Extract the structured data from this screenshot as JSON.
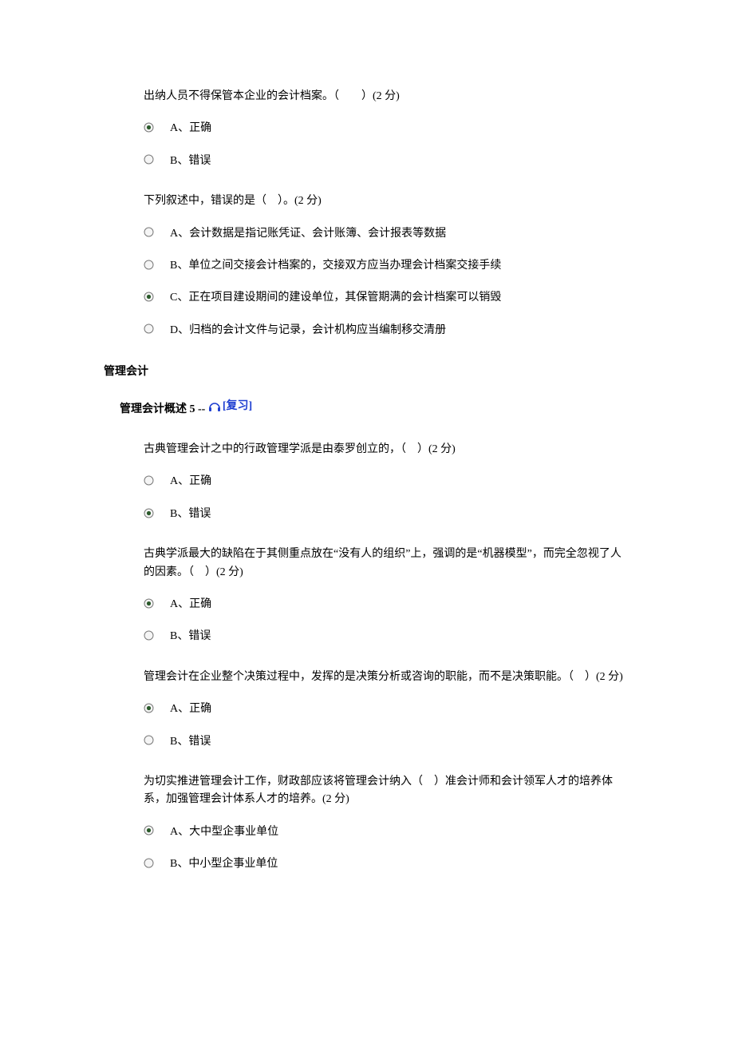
{
  "section1": {
    "q1": {
      "text": "出纳人员不得保管本企业的会计档案。（　　）(2 分)",
      "a": "A、正确",
      "b": "B、错误"
    },
    "q2": {
      "text": "下列叙述中，错误的是（　）。(2 分)",
      "a": "A、会计数据是指记账凭证、会计账簿、会计报表等数据",
      "b": "B、单位之间交接会计档案的，交接双方应当办理会计档案交接手续",
      "c": "C、正在项目建设期间的建设单位，其保管期满的会计档案可以销毁",
      "d": "D、归档的会计文件与记录，会计机构应当编制移交清册"
    }
  },
  "heading": "管理会计",
  "subsection": {
    "title": "管理会计概述 5",
    "sep": " -- ",
    "review": "[复习]"
  },
  "section2": {
    "q1": {
      "text": "古典管理会计之中的行政管理学派是由泰罗创立的，（　）(2 分)",
      "a": "A、正确",
      "b": "B、错误"
    },
    "q2": {
      "text": "古典学派最大的缺陷在于其侧重点放在“没有人的组织”上，强调的是“机器模型”，而完全忽视了人的因素。（　）(2 分)",
      "a": "A、正确",
      "b": "B、错误"
    },
    "q3": {
      "text": "管理会计在企业整个决策过程中，发挥的是决策分析或咨询的职能，而不是决策职能。（　）(2 分)",
      "a": "A、正确",
      "b": "B、错误"
    },
    "q4": {
      "text": "为切实推进管理会计工作，财政部应该将管理会计纳入（　）准会计师和会计领军人才的培养体系，加强管理会计体系人才的培养。(2 分)",
      "a": "A、大中型企事业单位",
      "b": "B、中小型企事业单位"
    }
  }
}
